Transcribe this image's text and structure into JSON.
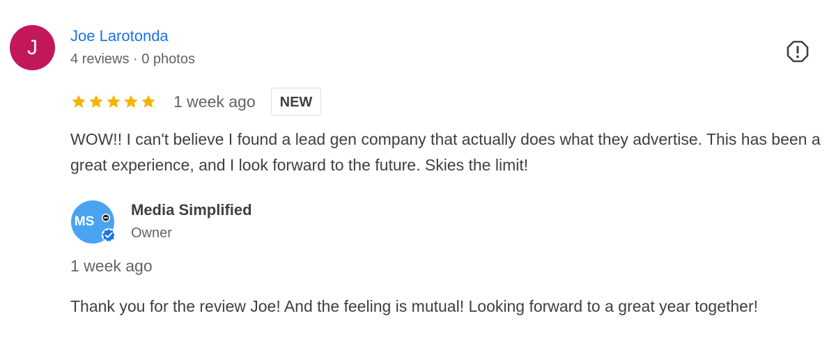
{
  "review": {
    "reviewer": {
      "initial": "J",
      "name": "Joe Larotonda",
      "meta": "4 reviews · 0 photos",
      "avatar_color": "#c2185b"
    },
    "rating": 5,
    "time_ago": "1 week ago",
    "badge": "NEW",
    "text": "WOW!! I can't believe I found a lead gen company that actually does what they advertise. This has been a great experience, and I look forward to the future. Skies the limit!",
    "icons": {
      "flag": "report-flag-icon",
      "star": "star-icon"
    },
    "colors": {
      "name_link": "#1a73e8",
      "star": "#f4b400"
    }
  },
  "reply": {
    "owner": {
      "logo_text": "MS",
      "name": "Media Simplified",
      "role": "Owner",
      "logo_color": "#4aa3f0"
    },
    "time_ago": "1 week ago",
    "text": "Thank you for the review Joe! And the feeling is mutual! Looking forward to a great year together!"
  }
}
